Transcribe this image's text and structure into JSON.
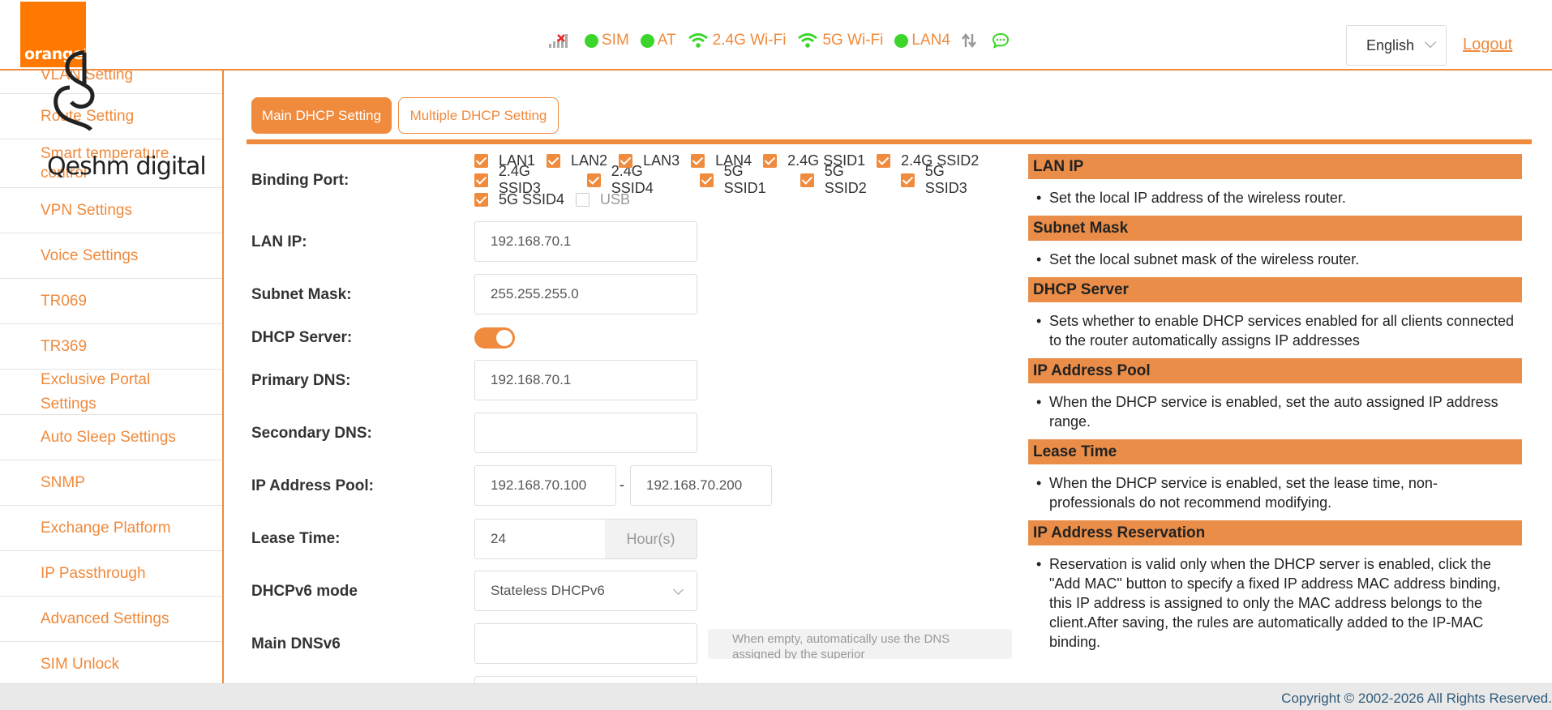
{
  "header": {
    "logo_text": "orange",
    "status": [
      {
        "name": "signal-icon",
        "label": ""
      },
      {
        "name": "sim",
        "label": "SIM"
      },
      {
        "name": "at",
        "label": "AT"
      },
      {
        "name": "wifi24",
        "label": "2.4G Wi-Fi"
      },
      {
        "name": "wifi5",
        "label": "5G Wi-Fi"
      },
      {
        "name": "lan4",
        "label": "LAN4"
      }
    ],
    "language": "English",
    "logout": "Logout"
  },
  "sidebar": {
    "items": [
      "VLAN Setting",
      "Route Setting",
      "Smart temperature control",
      "VPN Settings",
      "Voice Settings",
      "TR069",
      "TR369",
      "Exclusive Portal Settings",
      "Auto Sleep Settings",
      "SNMP",
      "Exchange Platform",
      "IP Passthrough",
      "Advanced Settings",
      "SIM Unlock"
    ],
    "watermark": "Qeshm digital"
  },
  "tabs": {
    "main": "Main DHCP Setting",
    "multiple": "Multiple DHCP Setting"
  },
  "form": {
    "binding_port_label": "Binding Port:",
    "ports": [
      {
        "label": "LAN1",
        "checked": true
      },
      {
        "label": "LAN2",
        "checked": true
      },
      {
        "label": "LAN3",
        "checked": true
      },
      {
        "label": "LAN4",
        "checked": true
      },
      {
        "label": "2.4G SSID1",
        "checked": true
      },
      {
        "label": "2.4G SSID2",
        "checked": true
      },
      {
        "label": "2.4G SSID3",
        "checked": true
      },
      {
        "label": "2.4G SSID4",
        "checked": true
      },
      {
        "label": "5G SSID1",
        "checked": true
      },
      {
        "label": "5G SSID2",
        "checked": true
      },
      {
        "label": "5G SSID3",
        "checked": true
      },
      {
        "label": "5G SSID4",
        "checked": true
      },
      {
        "label": "USB",
        "checked": false
      }
    ],
    "lan_ip_label": "LAN IP:",
    "lan_ip": "192.168.70.1",
    "subnet_label": "Subnet Mask:",
    "subnet": "255.255.255.0",
    "dhcp_server_label": "DHCP Server:",
    "dhcp_server_on": true,
    "primary_dns_label": "Primary DNS:",
    "primary_dns": "192.168.70.1",
    "secondary_dns_label": "Secondary DNS:",
    "secondary_dns": "",
    "pool_label": "IP Address Pool:",
    "pool_start": "192.168.70.100",
    "pool_sep": "-",
    "pool_end": "192.168.70.200",
    "lease_label": "Lease Time:",
    "lease": "24",
    "lease_unit": "Hour(s)",
    "dhcpv6_label": "DHCPv6 mode",
    "dhcpv6": "Stateless DHCPv6",
    "main_dnsv6_label": "Main DNSv6",
    "main_dnsv6": "",
    "dnsv6_hint": "When empty, automatically use the DNS assigned by the superior"
  },
  "help": [
    {
      "title": "LAN IP",
      "text": "Set the local IP address of the wireless router."
    },
    {
      "title": "Subnet Mask",
      "text": "Set the local subnet mask of the wireless router."
    },
    {
      "title": "DHCP Server",
      "text": "Sets whether to enable DHCP services enabled for all clients connected to the router automatically assigns IP addresses"
    },
    {
      "title": "IP Address Pool",
      "text": "When the DHCP service is enabled, set the auto assigned IP address range."
    },
    {
      "title": "Lease Time",
      "text": "When the DHCP service is enabled, set the lease time, non-professionals do not recommend modifying."
    },
    {
      "title": "IP Address Reservation",
      "text": "Reservation is valid only when the DHCP server is enabled, click the \"Add MAC\" button to specify a fixed IP address MAC address binding, this IP address is assigned to only the MAC address belongs to the client.After saving, the rules are automatically added to the IP-MAC binding."
    }
  ],
  "footer": "Copyright © 2002-2026 All Rights Reserved."
}
